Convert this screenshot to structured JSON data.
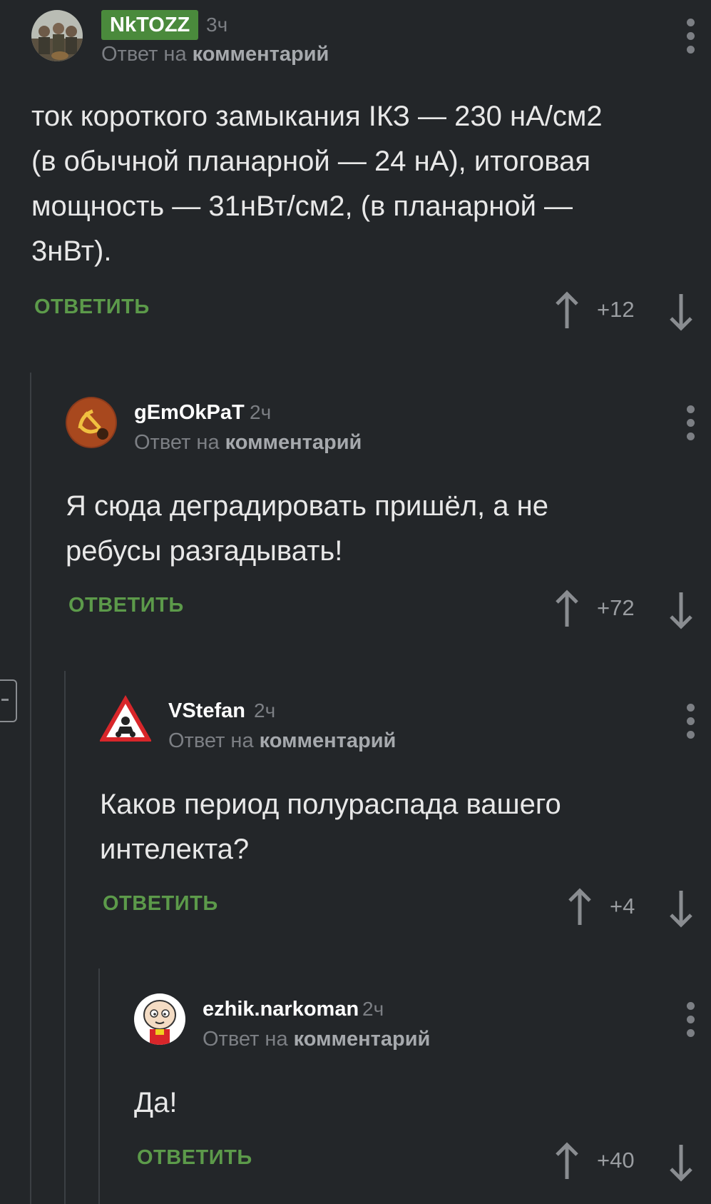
{
  "comments": [
    {
      "author": "NkTOZZ",
      "time": "3ч",
      "reply_prefix": "Ответ на",
      "reply_target": "комментарий",
      "lines": [
        "ток короткого замыкания IКЗ — 230 нА/см2",
        "(в обычной планарной — 24 нА), итоговая",
        "мощность — 31нВт/см2, (в планарной —",
        "3нВт)."
      ],
      "reply_label": "ОТВЕТИТЬ",
      "score": "+12"
    },
    {
      "author": "gEmOkPaT",
      "time": "2ч",
      "reply_prefix": "Ответ на",
      "reply_target": "комментарий",
      "lines": [
        "Я сюда деградировать пришёл, а не",
        "ребусы разгадывать!"
      ],
      "reply_label": "ОТВЕТИТЬ",
      "score": "+72"
    },
    {
      "author": "VStefan",
      "time": "2ч",
      "reply_prefix": "Ответ на",
      "reply_target": "комментарий",
      "lines": [
        "Каков период полураспада вашего",
        "интелекта?"
      ],
      "reply_label": "ОТВЕТИТЬ",
      "score": "+4"
    },
    {
      "author": "ezhik.narkoman",
      "time": "2ч",
      "reply_prefix": "Ответ на",
      "reply_target": "комментарий",
      "lines": [
        "Да!"
      ],
      "reply_label": "ОТВЕТИТЬ",
      "score": "+40"
    }
  ],
  "colors": {
    "background": "#232629",
    "accent_green": "#5c9a4a",
    "badge_green": "#4a8a3c",
    "muted": "#7c7f84"
  },
  "icons": {
    "upvote": "arrow-up-icon",
    "downvote": "arrow-down-icon",
    "menu": "more-vertical-icon",
    "collapse": "collapse-thread-icon"
  }
}
